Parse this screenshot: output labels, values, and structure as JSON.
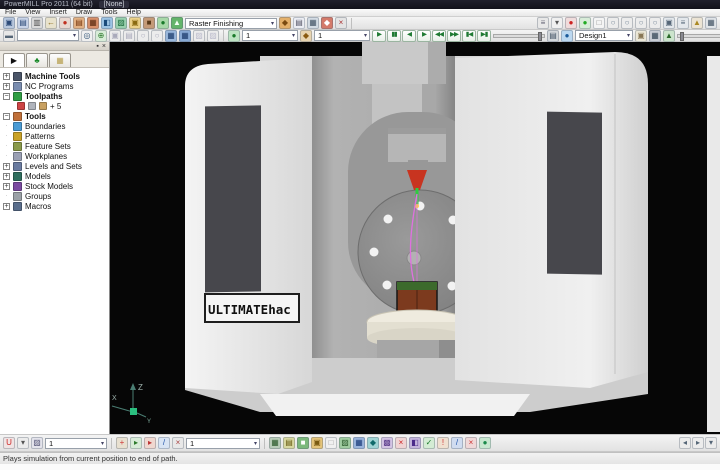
{
  "window": {
    "title": "PowerMILL Pro 2011 (64 bit)",
    "doc": "[None]"
  },
  "menu": {
    "items": [
      "File",
      "View",
      "Insert",
      "Draw",
      "Tools",
      "Help"
    ]
  },
  "toolbar_main": {
    "strategy_combo": "Raster Finishing",
    "left_icons": [
      {
        "n": "open-project-icon",
        "g": "▣",
        "c": "#b9c8de",
        "fg": "#2c4a78"
      },
      {
        "n": "save-project-icon",
        "g": "▤",
        "c": "#c9d4e8",
        "fg": "#2c4a78"
      },
      {
        "n": "print-icon",
        "g": "▥",
        "c": "#dadada",
        "fg": "#555555"
      },
      {
        "n": "undo-icon",
        "g": "←",
        "c": "#e8e2cc",
        "fg": "#8a6a1a"
      },
      {
        "n": "macro-record-icon",
        "g": "●",
        "c": "#e8d8d0",
        "fg": "#c03020"
      },
      {
        "n": "forms-icon",
        "g": "▤",
        "c": "#e2b184",
        "fg": "#7a3a10"
      },
      {
        "n": "calculator-icon",
        "g": "▦",
        "c": "#d8906a",
        "fg": "#5a2a10"
      },
      {
        "n": "paint-icon",
        "g": "◧",
        "c": "#9ec4e4",
        "fg": "#1a4a7a"
      },
      {
        "n": "swatch-icon",
        "g": "▨",
        "c": "#9ad0ae",
        "fg": "#1a6a3a"
      },
      {
        "n": "folder-icon",
        "g": "▣",
        "c": "#ecd28a",
        "fg": "#8a6a10"
      },
      {
        "n": "block-icon",
        "g": "■",
        "c": "#c49a78",
        "fg": "#5a3a1a"
      },
      {
        "n": "collision-check-icon",
        "g": "●",
        "c": "#a8d8a8",
        "fg": "#1a7a2a"
      },
      {
        "n": "strategies-icon",
        "g": "▲",
        "c": "#64b46a",
        "fg": "#f4fff4"
      }
    ],
    "mid_icons": [
      {
        "n": "toolpath-edit-icon",
        "g": "◆",
        "c": "#e4b06a",
        "fg": "#7a4a10"
      },
      {
        "n": "notes-icon",
        "g": "▤",
        "c": "#eceef4",
        "fg": "#555566"
      },
      {
        "n": "spreadsheet-icon",
        "g": "▦",
        "c": "#d4dce4",
        "fg": "#445566"
      },
      {
        "n": "post-icon",
        "g": "◆",
        "c": "#d47a6a",
        "fg": "#ffffff"
      },
      {
        "n": "delete-icon",
        "g": "×",
        "c": "#e4e4e4",
        "fg": "#aa3333"
      }
    ],
    "right_icons": [
      {
        "n": "font-size-icon",
        "g": "≡",
        "c": "#e8e8e8",
        "fg": "#666677"
      },
      {
        "n": "dropdown-icon",
        "g": "▾",
        "c": "#f0f0f0",
        "fg": "#555555"
      },
      {
        "n": "stop-icon",
        "g": "●",
        "c": "#f0dcdc",
        "fg": "#cc2222"
      },
      {
        "n": "go-icon",
        "g": "●",
        "c": "#d8ecd8",
        "fg": "#22aa22"
      },
      {
        "n": "frame-icon",
        "g": "□",
        "c": "#f4f4f4",
        "fg": "#888888"
      },
      {
        "n": "view-iso1-icon",
        "g": "○",
        "c": "#ececec",
        "fg": "#778899"
      },
      {
        "n": "view-iso2-icon",
        "g": "○",
        "c": "#ececec",
        "fg": "#778899"
      },
      {
        "n": "view-iso3-icon",
        "g": "○",
        "c": "#ececec",
        "fg": "#778899"
      },
      {
        "n": "view-iso4-icon",
        "g": "○",
        "c": "#ececec",
        "fg": "#778899"
      },
      {
        "n": "refresh-icon",
        "g": "▣",
        "c": "#e4e8ec",
        "fg": "#556677"
      },
      {
        "n": "levels-icon",
        "g": "≡",
        "c": "#e4e8ec",
        "fg": "#556677"
      },
      {
        "n": "flag-icon",
        "g": "▲",
        "c": "#ece4d4",
        "fg": "#aa8822"
      },
      {
        "n": "grid-icon",
        "g": "▦",
        "c": "#e0e4e8",
        "fg": "#445566"
      }
    ]
  },
  "toolbar_sim": {
    "empty_combo": "",
    "toolpath_combo": "1",
    "tool_combo": "1",
    "design_combo": "Design1",
    "left_icons": [
      {
        "n": "pattern-icon",
        "g": "▬",
        "c": "#e8e8e8",
        "fg": "#556677"
      }
    ],
    "mid_icons": [
      {
        "n": "target-icon",
        "g": "◎",
        "c": "#f0f0f0",
        "fg": "#335577"
      },
      {
        "n": "gear-icon",
        "g": "⊕",
        "c": "#d8ecd8",
        "fg": "#2a7a2a"
      },
      {
        "n": "open-faded-icon",
        "g": "▣",
        "c": "#ececec",
        "fg": "#aaaabb"
      },
      {
        "n": "save-faded-icon",
        "g": "▤",
        "c": "#ececec",
        "fg": "#aaaabb"
      },
      {
        "n": "prev-faded-icon",
        "g": "○",
        "c": "#ececec",
        "fg": "#aaaabb"
      },
      {
        "n": "next-faded-icon",
        "g": "○",
        "c": "#ececec",
        "fg": "#aaaabb"
      },
      {
        "n": "screen1-icon",
        "g": "▦",
        "c": "#9ab8dc",
        "fg": "#1a3a6a"
      },
      {
        "n": "screen2-icon",
        "g": "▦",
        "c": "#88aad4",
        "fg": "#1a3a6a"
      },
      {
        "n": "ghost1-icon",
        "g": "▨",
        "c": "#ececec",
        "fg": "#bbbbcc"
      },
      {
        "n": "ghost2-icon",
        "g": "▨",
        "c": "#ececec",
        "fg": "#bbbbcc"
      }
    ],
    "toolpath_icon": [
      {
        "n": "toolpath-sim-icon",
        "g": "●",
        "c": "#bfe4c4",
        "fg": "#1a7a2a"
      }
    ],
    "tool_icon": [
      {
        "n": "tool-sim-icon",
        "g": "◆",
        "c": "#e8d4b0",
        "fg": "#8a5a10"
      }
    ],
    "playback": [
      {
        "n": "play-button",
        "g": "▶",
        "k": "pb"
      },
      {
        "n": "pause-button",
        "g": "▮▮",
        "k": "pb"
      },
      {
        "n": "step-back-button",
        "g": "◀",
        "k": "pb"
      },
      {
        "n": "step-forward-button",
        "g": "▶",
        "k": "pb"
      },
      {
        "n": "search-back-button",
        "g": "◀◀",
        "k": "pb"
      },
      {
        "n": "search-forward-button",
        "g": "▶▶",
        "k": "pb"
      },
      {
        "n": "go-to-start-button",
        "g": "▮◀",
        "k": "pb"
      },
      {
        "n": "go-to-end-button",
        "g": "▶▮",
        "k": "pb"
      }
    ],
    "right_icons": [
      {
        "n": "stack-icon",
        "g": "▤",
        "c": "#d4d8dc",
        "fg": "#445566"
      },
      {
        "n": "world-icon",
        "g": "●",
        "c": "#bcd8f0",
        "fg": "#1a5a9a"
      }
    ],
    "far_right_icons": [
      {
        "n": "frame2-icon",
        "g": "▣",
        "c": "#ece8d8",
        "fg": "#887755"
      },
      {
        "n": "machine-icon",
        "g": "▦",
        "c": "#c8ccd4",
        "fg": "#334455"
      },
      {
        "n": "tree-icon",
        "g": "▲",
        "c": "#cce4cc",
        "fg": "#2a6a2a"
      }
    ],
    "end_icons": [
      {
        "n": "left-arrow-icon",
        "g": "◂",
        "c": "#ececec",
        "fg": "#556677"
      },
      {
        "n": "right-arrow-icon",
        "g": "▸",
        "c": "#ececec",
        "fg": "#556677"
      }
    ]
  },
  "toolbar_bottom": {
    "combo1": "1",
    "combo2": "1",
    "left_icons": [
      {
        "n": "undo-clamp-icon",
        "g": "U",
        "c": "#f0e4e4",
        "fg": "#cc2222"
      },
      {
        "n": "clamp-caret-icon",
        "g": "▾",
        "c": "#ececec",
        "fg": "#555555"
      },
      {
        "n": "angle-icon",
        "g": "▨",
        "c": "#e4e4ec",
        "fg": "#555577"
      }
    ],
    "mid_icons": [
      {
        "n": "axis-icon",
        "g": "+",
        "c": "#e8e0d0",
        "fg": "#cc3333"
      },
      {
        "n": "leads-icon",
        "g": "▸",
        "c": "#d8ecd8",
        "fg": "#2a7a2a"
      },
      {
        "n": "links-icon",
        "g": "▸",
        "c": "#f0d8d0",
        "fg": "#bb3333"
      },
      {
        "n": "draw-icon",
        "g": "/",
        "c": "#d8e4f4",
        "fg": "#2255aa"
      },
      {
        "n": "erase-icon",
        "g": "×",
        "c": "#e8e8e8",
        "fg": "#aa4444"
      }
    ],
    "right_icons": [
      {
        "n": "block-view-icon",
        "g": "▦",
        "c": "#b9cdb9",
        "fg": "#2a5a2a"
      },
      {
        "n": "material-icon",
        "g": "▤",
        "c": "#d8d8a0",
        "fg": "#665a10"
      },
      {
        "n": "shade-icon",
        "g": "■",
        "c": "#7cb87c",
        "fg": "#ffffff"
      },
      {
        "n": "wireframe-icon",
        "g": "▣",
        "c": "#e4c47a",
        "fg": "#7a5a10"
      },
      {
        "n": "blank-icon",
        "g": "□",
        "c": "#f0f0f0",
        "fg": "#999999"
      },
      {
        "n": "leaf-icon",
        "g": "▨",
        "c": "#a0cca0",
        "fg": "#2a5a2a"
      },
      {
        "n": "blue-grid-icon",
        "g": "▦",
        "c": "#9ab4dc",
        "fg": "#1a3a7a"
      },
      {
        "n": "cyan-gem-icon",
        "g": "◆",
        "c": "#a0d4d4",
        "fg": "#106a6a"
      },
      {
        "n": "multi-icon",
        "g": "▩",
        "c": "#d4c4e4",
        "fg": "#5a3a8a"
      },
      {
        "n": "red-x-icon",
        "g": "×",
        "c": "#f0d4d4",
        "fg": "#cc2222"
      },
      {
        "n": "purple-icon",
        "g": "◧",
        "c": "#c4b4dc",
        "fg": "#4a2a8a"
      },
      {
        "n": "check-icon",
        "g": "✓",
        "c": "#d4ecd4",
        "fg": "#1a7a2a"
      },
      {
        "n": "alert-icon",
        "g": "!",
        "c": "#f0e0d0",
        "fg": "#cc3333"
      },
      {
        "n": "pen-icon",
        "g": "/",
        "c": "#d0dcf0",
        "fg": "#2255aa"
      },
      {
        "n": "cross-icon",
        "g": "×",
        "c": "#f0d8d8",
        "fg": "#cc3333"
      },
      {
        "n": "sphere-icon",
        "g": "●",
        "c": "#c8e8d0",
        "fg": "#1a8a4a"
      }
    ],
    "nav_icons": [
      {
        "n": "nav-back-icon",
        "g": "◂",
        "c": "#ececec",
        "fg": "#556677"
      },
      {
        "n": "nav-forward-icon",
        "g": "▸",
        "c": "#ececec",
        "fg": "#556677"
      },
      {
        "n": "mini-caret-icon",
        "g": "▾",
        "c": "#ececec",
        "fg": "#556677"
      }
    ]
  },
  "explorer": {
    "close": "×",
    "pin": "▪",
    "tabs": [
      {
        "n": "explorer-tab",
        "g": "▶",
        "fg": "#111111"
      },
      {
        "n": "tree-view-tab",
        "g": "♣",
        "fg": "#1a8a2a"
      },
      {
        "n": "hints-tab",
        "g": "▦",
        "fg": "#b8a050"
      }
    ],
    "items": [
      {
        "label": "Machine Tools",
        "bold": true,
        "color": "#4a5568",
        "expand": "+"
      },
      {
        "label": "NC Programs",
        "bold": false,
        "color": "#7a8db0",
        "expand": "+"
      },
      {
        "label": "Toolpaths",
        "bold": true,
        "color": "#2f9e44",
        "expand": "-"
      },
      {
        "sub": true,
        "label": "+ 5",
        "icons": [
          "#cc4444",
          "#b0b4bc",
          "#c8a060"
        ]
      },
      {
        "label": "Tools",
        "bold": true,
        "color": "#c0703a",
        "expand": "-"
      },
      {
        "label": "Boundaries",
        "bold": false,
        "color": "#4a9bd4",
        "expand": ""
      },
      {
        "label": "Patterns",
        "bold": false,
        "color": "#c9a227",
        "expand": ""
      },
      {
        "label": "Feature Sets",
        "bold": false,
        "color": "#8a9a4a",
        "expand": ""
      },
      {
        "label": "Workplanes",
        "bold": false,
        "color": "#9aa0b4",
        "expand": ""
      },
      {
        "label": "Levels and Sets",
        "bold": false,
        "color": "#6a7ba0",
        "expand": "+"
      },
      {
        "label": "Models",
        "bold": false,
        "color": "#2f6e5e",
        "expand": "+"
      },
      {
        "label": "Stock Models",
        "bold": false,
        "color": "#7a4aa0",
        "expand": "+"
      },
      {
        "label": "Groups",
        "bold": false,
        "color": "#9aa0a6",
        "expand": ""
      },
      {
        "label": "Macros",
        "bold": false,
        "color": "#5a6e8c",
        "expand": "+"
      }
    ]
  },
  "viewport": {
    "plate_text": "ULTIMATEhac",
    "axis_z": "Z",
    "axis_x": "X",
    "axis_y": "Y",
    "colors": {
      "tool_green": "#2ecc40",
      "collet_red": "#c83420",
      "toolpath_magenta": "#e070e0",
      "stock_brown": "#7c3a1e",
      "machine_light": "#ececec"
    }
  },
  "statusbar": {
    "text": "Plays simulation from current position to end of path."
  }
}
